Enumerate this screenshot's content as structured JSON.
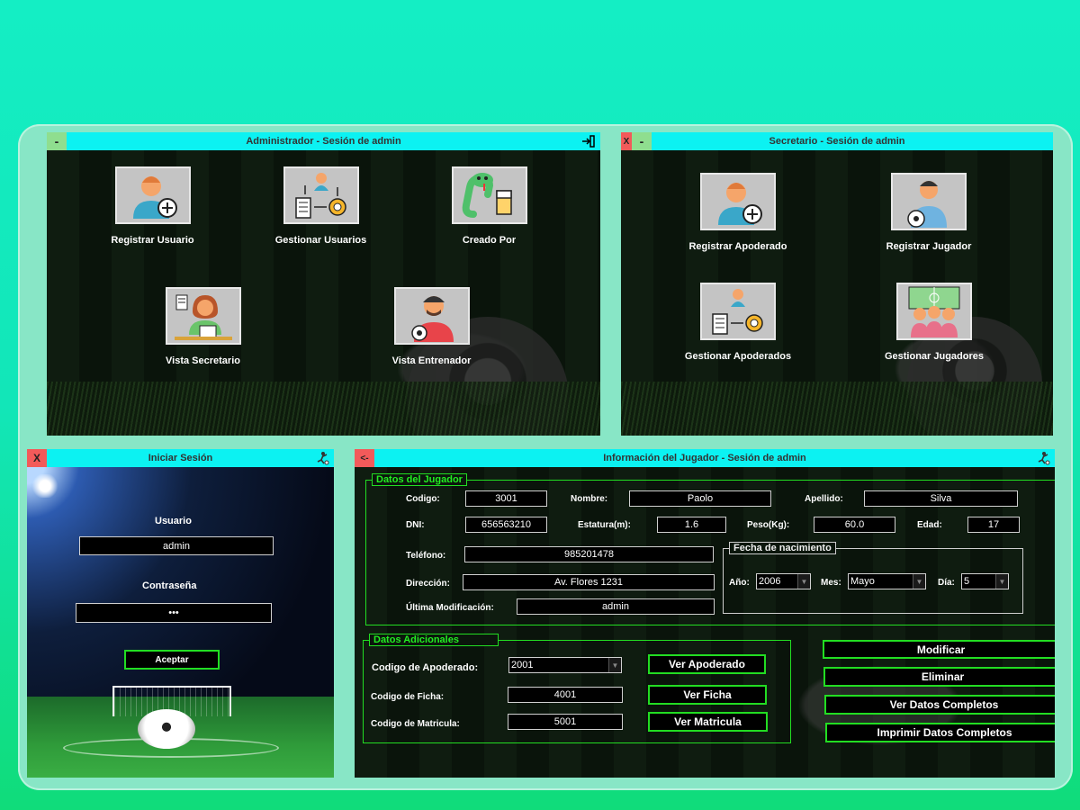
{
  "admin_window": {
    "title": "Administrador - Sesión de admin",
    "min_label": "-",
    "tiles": [
      {
        "label": "Registrar Usuario",
        "icon": "user-add-icon"
      },
      {
        "label": "Gestionar Usuarios",
        "icon": "manage-users-icon"
      },
      {
        "label": "Creado Por",
        "icon": "snake-icon"
      },
      {
        "label": "Vista Secretario",
        "icon": "secretary-icon"
      },
      {
        "label": "Vista Entrenador",
        "icon": "coach-icon"
      }
    ]
  },
  "secretary_window": {
    "title": "Secretario - Sesión de admin",
    "close_label": "X",
    "min_label": "-",
    "tiles": [
      {
        "label": "Registrar Apoderado",
        "icon": "user-add-icon"
      },
      {
        "label": "Registrar Jugador",
        "icon": "player-icon"
      },
      {
        "label": "Gestionar Apoderados",
        "icon": "manage-users-icon"
      },
      {
        "label": "Gestionar Jugadores",
        "icon": "team-icon"
      }
    ]
  },
  "login_window": {
    "title": "Iniciar Sesión",
    "close_label": "X",
    "user_label": "Usuario",
    "user_value": "admin",
    "password_label": "Contraseña",
    "password_value": "•••",
    "accept_label": "Aceptar"
  },
  "player_window": {
    "title": "Información del Jugador - Sesión de admin",
    "back_label": "<-",
    "player_group_title": "Datos del Jugador",
    "fields": {
      "codigo_label": "Codigo:",
      "codigo": "3001",
      "nombre_label": "Nombre:",
      "nombre": "Paolo",
      "apellido_label": "Apellido:",
      "apellido": "Silva",
      "dni_label": "DNI:",
      "dni": "656563210",
      "estatura_label": "Estatura(m):",
      "estatura": "1.6",
      "peso_label": "Peso(Kg):",
      "peso": "60.0",
      "edad_label": "Edad:",
      "edad": "17",
      "telefono_label": "Teléfono:",
      "telefono": "985201478",
      "direccion_label": "Dirección:",
      "direccion": "Av. Flores 1231",
      "ultima_label": "Última Modificación:",
      "ultima": "admin"
    },
    "birth_group_title": "Fecha de nacimiento",
    "birth": {
      "anio_label": "Año:",
      "anio": "2006",
      "mes_label": "Mes:",
      "mes": "Mayo",
      "dia_label": "Día:",
      "dia": "5"
    },
    "extra_group_title": "Datos Adicionales",
    "extra": {
      "apoderado_label": "Codigo de Apoderado:",
      "apoderado": "2001",
      "ficha_label": "Codigo de Ficha:",
      "ficha": "4001",
      "matricula_label": "Codigo de Matricula:",
      "matricula": "5001",
      "ver_apoderado": "Ver Apoderado",
      "ver_ficha": "Ver Ficha",
      "ver_matricula": "Ver Matricula"
    },
    "actions": {
      "modificar": "Modificar",
      "eliminar": "Eliminar",
      "ver_completos": "Ver Datos Completos",
      "imprimir": "Imprimir Datos Completos"
    }
  },
  "colors": {
    "titlebar": "#0cf2f2",
    "accent": "#22dd22",
    "close": "#f25a5a",
    "minimize": "#8fde8f"
  }
}
